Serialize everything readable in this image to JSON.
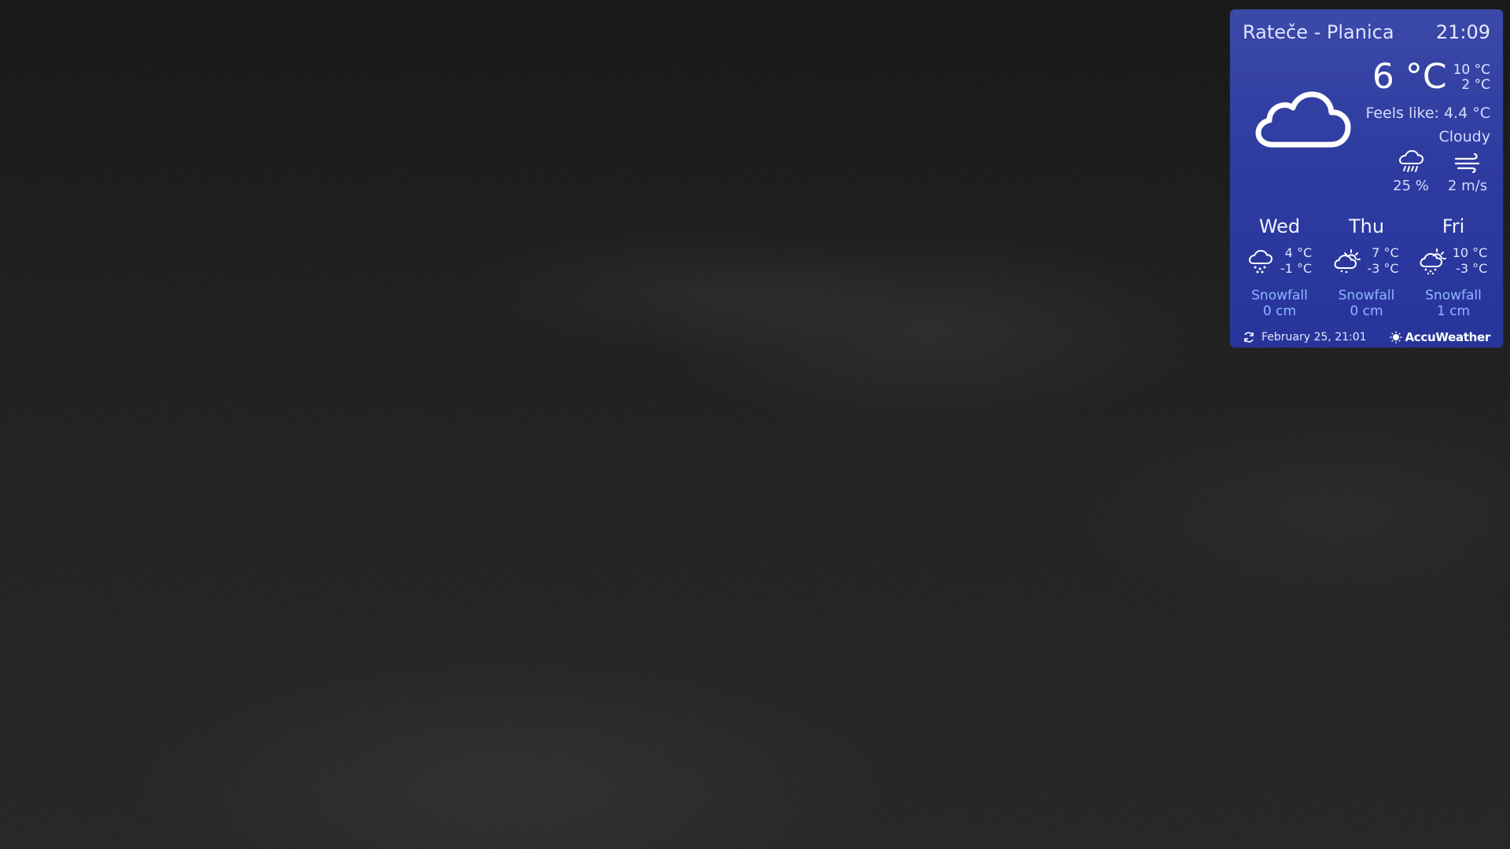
{
  "widget": {
    "location": "Rateče - Planica",
    "time": "21:09",
    "current": {
      "icon": "cloud-icon",
      "temperature": "6 °C",
      "high": "10 °C",
      "low": "2 °C",
      "feels_like": "Feels like: 4.4 °C",
      "condition": "Cloudy",
      "precip_icon": "rain-cloud-icon",
      "precipitation": "25 %",
      "wind_icon": "wind-icon",
      "wind": "2 m/s"
    },
    "forecast": [
      {
        "day": "Wed",
        "icon": "snow-cloud-icon",
        "high": "4 °C",
        "low": "-1 °C",
        "snow_label": "Snowfall",
        "snow_amount": "0 cm"
      },
      {
        "day": "Thu",
        "icon": "sun-cloud-icon",
        "high": "7 °C",
        "low": "-3 °C",
        "snow_label": "Snowfall",
        "snow_amount": "0 cm"
      },
      {
        "day": "Fri",
        "icon": "sun-cloud-snow-icon",
        "high": "10 °C",
        "low": "-3 °C",
        "snow_label": "Snowfall",
        "snow_amount": "1 cm"
      }
    ],
    "updated": "February 25, 21:01",
    "brand": "AccuWeather"
  },
  "colors": {
    "widget_bg": "#2e3ba0",
    "snow_text": "#8fb6ff"
  }
}
